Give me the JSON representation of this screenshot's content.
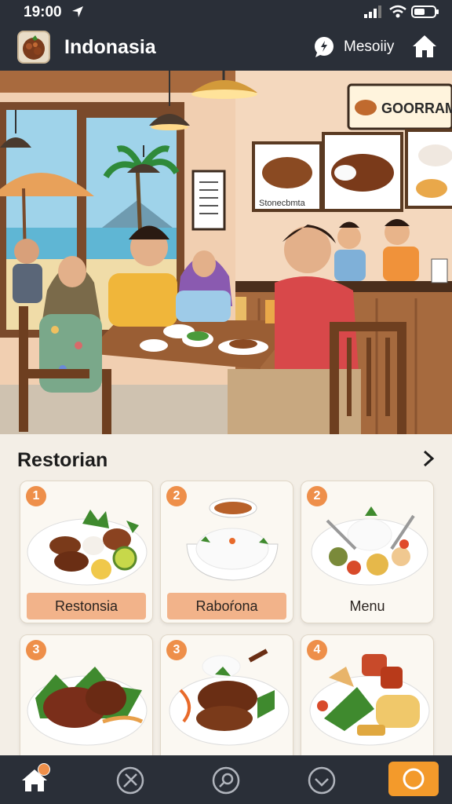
{
  "status_bar": {
    "time": "19:00"
  },
  "header": {
    "title": "Indonasia",
    "action_label": "Mesoiiy"
  },
  "hero": {
    "sign_text": "GOORRAM",
    "menu_board_caption": "Stonecbmta"
  },
  "section": {
    "title": "Restorian"
  },
  "cards": [
    {
      "number": "1",
      "label": "Restonsia"
    },
    {
      "number": "2",
      "label": "Raboŕona"
    },
    {
      "number": "2",
      "label": "Menu"
    },
    {
      "number": "3",
      "label": ""
    },
    {
      "number": "3",
      "label": ""
    },
    {
      "number": "4",
      "label": ""
    }
  ],
  "icons": {
    "status": [
      "location-arrow-icon",
      "signal-icon",
      "wifi-icon",
      "battery-icon"
    ],
    "header": [
      "app-food-icon",
      "chat-icon",
      "home-icon"
    ],
    "nav": [
      "home-icon",
      "tools-icon",
      "search-icon",
      "check-icon",
      "circle-icon"
    ]
  },
  "colors": {
    "bar": "#2a2f38",
    "accent": "#ee8f4a",
    "label_bg": "#f2b38a",
    "nav_active": "#f39a2b"
  }
}
